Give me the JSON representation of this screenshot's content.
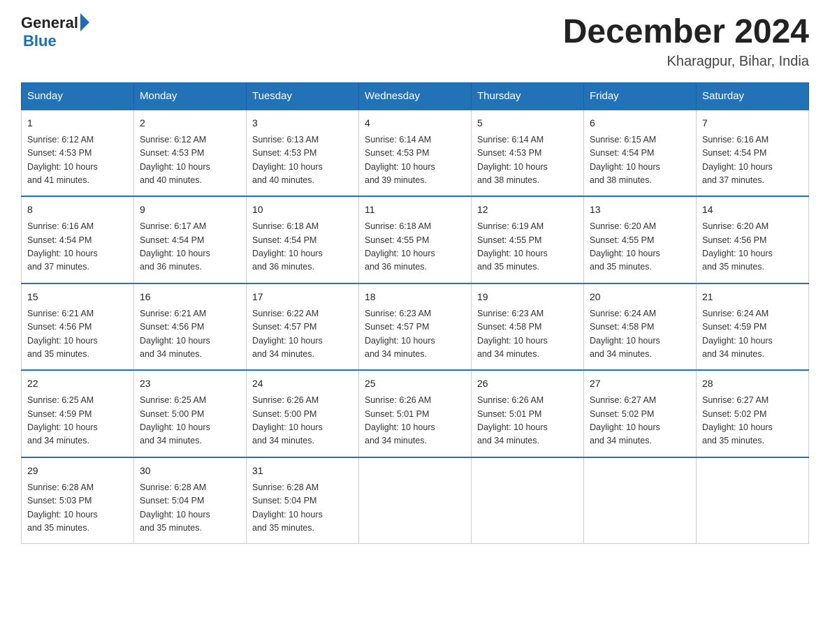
{
  "logo": {
    "general": "General",
    "blue": "Blue"
  },
  "title": "December 2024",
  "location": "Kharagpur, Bihar, India",
  "days_of_week": [
    "Sunday",
    "Monday",
    "Tuesday",
    "Wednesday",
    "Thursday",
    "Friday",
    "Saturday"
  ],
  "weeks": [
    [
      {
        "day": "1",
        "sunrise": "6:12 AM",
        "sunset": "4:53 PM",
        "daylight": "10 hours and 41 minutes."
      },
      {
        "day": "2",
        "sunrise": "6:12 AM",
        "sunset": "4:53 PM",
        "daylight": "10 hours and 40 minutes."
      },
      {
        "day": "3",
        "sunrise": "6:13 AM",
        "sunset": "4:53 PM",
        "daylight": "10 hours and 40 minutes."
      },
      {
        "day": "4",
        "sunrise": "6:14 AM",
        "sunset": "4:53 PM",
        "daylight": "10 hours and 39 minutes."
      },
      {
        "day": "5",
        "sunrise": "6:14 AM",
        "sunset": "4:53 PM",
        "daylight": "10 hours and 38 minutes."
      },
      {
        "day": "6",
        "sunrise": "6:15 AM",
        "sunset": "4:54 PM",
        "daylight": "10 hours and 38 minutes."
      },
      {
        "day": "7",
        "sunrise": "6:16 AM",
        "sunset": "4:54 PM",
        "daylight": "10 hours and 37 minutes."
      }
    ],
    [
      {
        "day": "8",
        "sunrise": "6:16 AM",
        "sunset": "4:54 PM",
        "daylight": "10 hours and 37 minutes."
      },
      {
        "day": "9",
        "sunrise": "6:17 AM",
        "sunset": "4:54 PM",
        "daylight": "10 hours and 36 minutes."
      },
      {
        "day": "10",
        "sunrise": "6:18 AM",
        "sunset": "4:54 PM",
        "daylight": "10 hours and 36 minutes."
      },
      {
        "day": "11",
        "sunrise": "6:18 AM",
        "sunset": "4:55 PM",
        "daylight": "10 hours and 36 minutes."
      },
      {
        "day": "12",
        "sunrise": "6:19 AM",
        "sunset": "4:55 PM",
        "daylight": "10 hours and 35 minutes."
      },
      {
        "day": "13",
        "sunrise": "6:20 AM",
        "sunset": "4:55 PM",
        "daylight": "10 hours and 35 minutes."
      },
      {
        "day": "14",
        "sunrise": "6:20 AM",
        "sunset": "4:56 PM",
        "daylight": "10 hours and 35 minutes."
      }
    ],
    [
      {
        "day": "15",
        "sunrise": "6:21 AM",
        "sunset": "4:56 PM",
        "daylight": "10 hours and 35 minutes."
      },
      {
        "day": "16",
        "sunrise": "6:21 AM",
        "sunset": "4:56 PM",
        "daylight": "10 hours and 34 minutes."
      },
      {
        "day": "17",
        "sunrise": "6:22 AM",
        "sunset": "4:57 PM",
        "daylight": "10 hours and 34 minutes."
      },
      {
        "day": "18",
        "sunrise": "6:23 AM",
        "sunset": "4:57 PM",
        "daylight": "10 hours and 34 minutes."
      },
      {
        "day": "19",
        "sunrise": "6:23 AM",
        "sunset": "4:58 PM",
        "daylight": "10 hours and 34 minutes."
      },
      {
        "day": "20",
        "sunrise": "6:24 AM",
        "sunset": "4:58 PM",
        "daylight": "10 hours and 34 minutes."
      },
      {
        "day": "21",
        "sunrise": "6:24 AM",
        "sunset": "4:59 PM",
        "daylight": "10 hours and 34 minutes."
      }
    ],
    [
      {
        "day": "22",
        "sunrise": "6:25 AM",
        "sunset": "4:59 PM",
        "daylight": "10 hours and 34 minutes."
      },
      {
        "day": "23",
        "sunrise": "6:25 AM",
        "sunset": "5:00 PM",
        "daylight": "10 hours and 34 minutes."
      },
      {
        "day": "24",
        "sunrise": "6:26 AM",
        "sunset": "5:00 PM",
        "daylight": "10 hours and 34 minutes."
      },
      {
        "day": "25",
        "sunrise": "6:26 AM",
        "sunset": "5:01 PM",
        "daylight": "10 hours and 34 minutes."
      },
      {
        "day": "26",
        "sunrise": "6:26 AM",
        "sunset": "5:01 PM",
        "daylight": "10 hours and 34 minutes."
      },
      {
        "day": "27",
        "sunrise": "6:27 AM",
        "sunset": "5:02 PM",
        "daylight": "10 hours and 34 minutes."
      },
      {
        "day": "28",
        "sunrise": "6:27 AM",
        "sunset": "5:02 PM",
        "daylight": "10 hours and 35 minutes."
      }
    ],
    [
      {
        "day": "29",
        "sunrise": "6:28 AM",
        "sunset": "5:03 PM",
        "daylight": "10 hours and 35 minutes."
      },
      {
        "day": "30",
        "sunrise": "6:28 AM",
        "sunset": "5:04 PM",
        "daylight": "10 hours and 35 minutes."
      },
      {
        "day": "31",
        "sunrise": "6:28 AM",
        "sunset": "5:04 PM",
        "daylight": "10 hours and 35 minutes."
      },
      null,
      null,
      null,
      null
    ]
  ],
  "labels": {
    "sunrise": "Sunrise:",
    "sunset": "Sunset:",
    "daylight": "Daylight:"
  }
}
